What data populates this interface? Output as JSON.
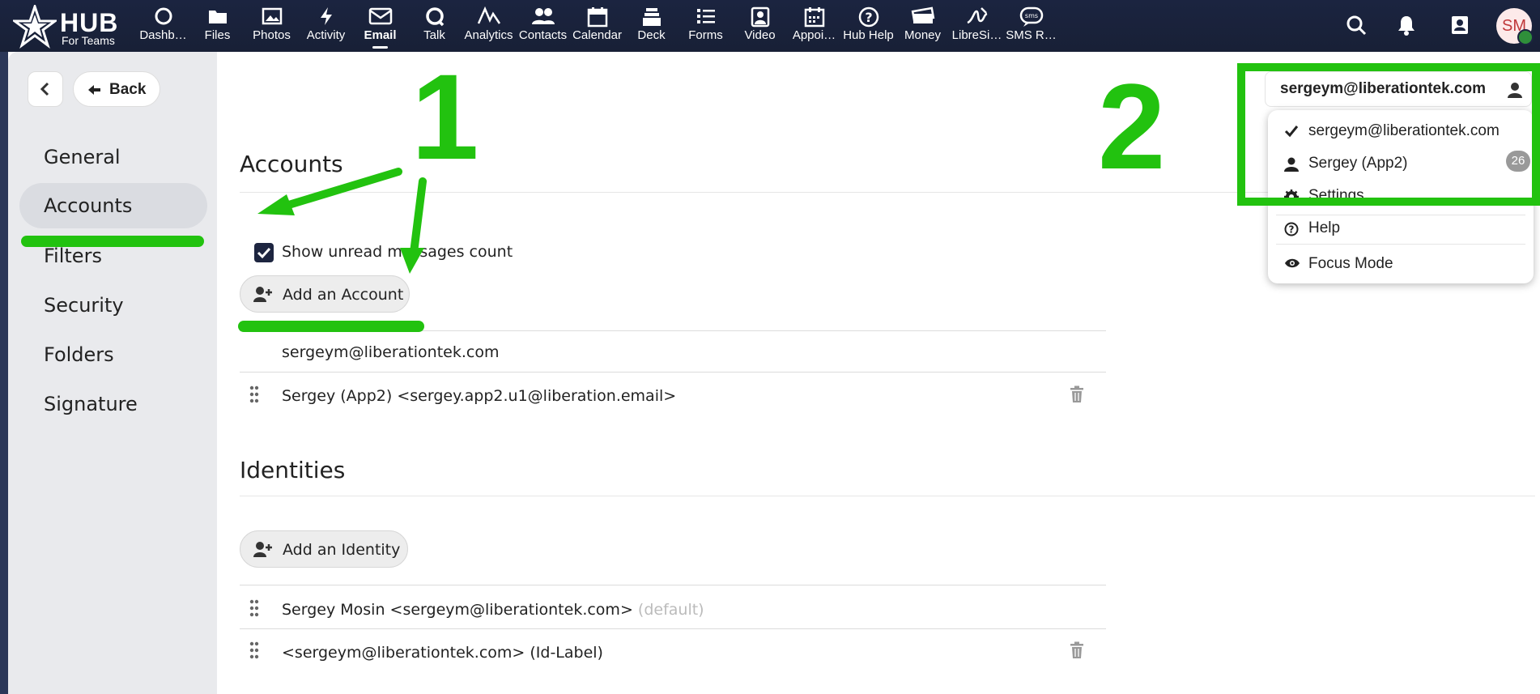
{
  "brand": {
    "name": "HUB",
    "tagline": "For Teams"
  },
  "apps": [
    {
      "label": "Dashb…",
      "icon": "dashboard-icon"
    },
    {
      "label": "Files",
      "icon": "folder-icon"
    },
    {
      "label": "Photos",
      "icon": "image-icon"
    },
    {
      "label": "Activity",
      "icon": "bolt-icon"
    },
    {
      "label": "Email",
      "icon": "email-icon",
      "active": true
    },
    {
      "label": "Talk",
      "icon": "talk-icon"
    },
    {
      "label": "Analytics",
      "icon": "analytics-icon"
    },
    {
      "label": "Contacts",
      "icon": "contacts-icon"
    },
    {
      "label": "Calendar",
      "icon": "calendar-icon"
    },
    {
      "label": "Deck",
      "icon": "deck-icon"
    },
    {
      "label": "Forms",
      "icon": "forms-icon"
    },
    {
      "label": "Video",
      "icon": "video-icon"
    },
    {
      "label": "Appoi…",
      "icon": "appointments-icon"
    },
    {
      "label": "Hub Help",
      "icon": "help-icon"
    },
    {
      "label": "Money",
      "icon": "money-icon"
    },
    {
      "label": "LibreSi…",
      "icon": "libresign-icon"
    },
    {
      "label": "SMS R…",
      "icon": "sms-icon"
    }
  ],
  "avatar": {
    "initials": "SM"
  },
  "sidebar": {
    "back_label": "Back",
    "items": [
      {
        "label": "General"
      },
      {
        "label": "Accounts",
        "active": true
      },
      {
        "label": "Filters"
      },
      {
        "label": "Security"
      },
      {
        "label": "Folders"
      },
      {
        "label": "Signature"
      }
    ]
  },
  "accounts": {
    "title": "Accounts",
    "show_unread_label": "Show unread messages count",
    "show_unread_checked": true,
    "add_label": "Add an Account",
    "rows": [
      {
        "text": "sergeym@liberationtek.com"
      },
      {
        "text": "Sergey (App2) <sergey.app2.u1@liberation.email>"
      }
    ]
  },
  "identities": {
    "title": "Identities",
    "add_label": "Add an Identity",
    "rows": [
      {
        "text": "Sergey Mosin <sergeym@liberationtek.com>",
        "suffix": "(default)"
      },
      {
        "text": "<sergeym@liberationtek.com> (Id-Label)"
      }
    ]
  },
  "account_menu": {
    "current": "sergeym@liberationtek.com",
    "items": [
      {
        "label": "sergeym@liberationtek.com",
        "icon": "check-icon"
      },
      {
        "label": "Sergey (App2)",
        "icon": "user-icon",
        "badge": "26"
      },
      {
        "label": "Settings",
        "icon": "gear-icon"
      },
      {
        "label": "Help",
        "icon": "help-circle-icon"
      },
      {
        "label": "Focus Mode",
        "icon": "eye-icon"
      }
    ]
  },
  "annotations": {
    "step1": "1",
    "step2": "2",
    "color": "#22c20f"
  }
}
